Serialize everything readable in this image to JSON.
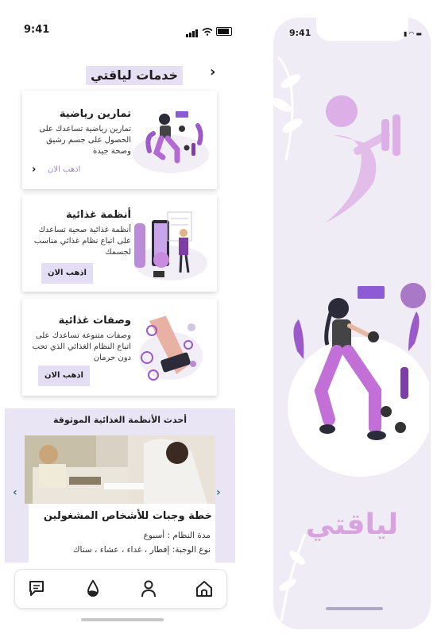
{
  "status_bar": {
    "time": "9:41"
  },
  "header": {
    "title": "خدمات لياقتي",
    "back_icon": "chevron-right-icon"
  },
  "services": [
    {
      "title": "تمارين رياضية",
      "description": "تمارين رياضية تساعدك على الحصول على جسم رشيق وصحة جيدة",
      "action": "اذهب الان",
      "illustration": "workout-illustration"
    },
    {
      "title": "أنظمة غذائية",
      "description": "أنظمة غذائية صحية تساعدك على اتباع نظام غذائي مناسب لجسمك",
      "action": "اذهب الان",
      "illustration": "nutrition-plan-illustration"
    },
    {
      "title": "وصفات غذائية",
      "description": "وصفات متنوعة تساعدك على اتباع النظام الغذائي الذي تحب دون حرمان",
      "action": "اذهب الان",
      "illustration": "recipe-illustration"
    }
  ],
  "latest_section": {
    "title": "أحدث الأنظمة الغذائية الموثوقة",
    "plan_title": "خطة وجبات للأشخاص المشغولين",
    "duration_line": "مدة النظام : أسبوع",
    "meal_type_line": "نوع الوجبة: إفطار ، غداء ، عشاء ، سناك"
  },
  "tab_bar": [
    {
      "name": "home-icon",
      "active": true
    },
    {
      "name": "profile-icon",
      "active": false
    },
    {
      "name": "water-drop-icon",
      "active": false
    },
    {
      "name": "chat-icon",
      "active": false
    }
  ],
  "splash": {
    "time": "9:41",
    "brand": "لياقتي"
  },
  "colors": {
    "accent": "#9b59c9",
    "accent_light": "#e4def5",
    "brand_pink": "#d9a3e0"
  }
}
